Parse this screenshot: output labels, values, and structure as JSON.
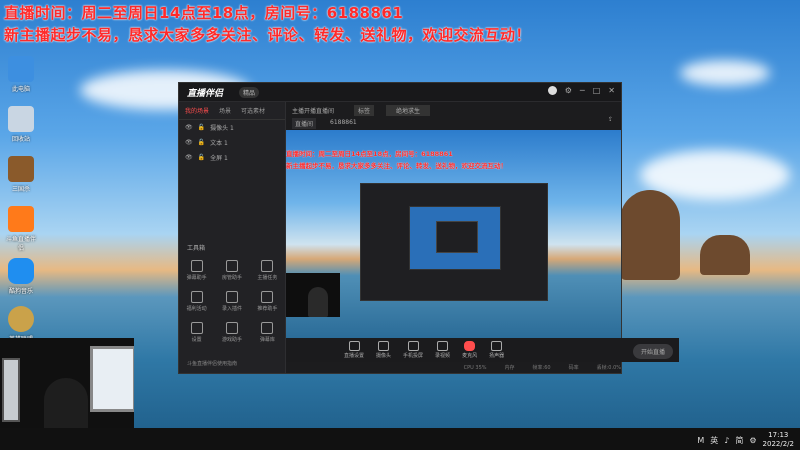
{
  "banner": {
    "line1": "直播时间：周二至周日14点至18点，房间号：6188861",
    "line2": "新主播起步不易，恳求大家多多关注、评论、转发、送礼物，欢迎交流互动！"
  },
  "desktop_icons": [
    {
      "label": "此电脑",
      "icon": "computer-icon",
      "color": "#3d8fe0"
    },
    {
      "label": "回收站",
      "icon": "recycle-bin-icon",
      "color": "#c9d6e3"
    },
    {
      "label": "三国杀",
      "icon": "game-icon",
      "color": "#8a5a2b"
    },
    {
      "label": "斗鱼直播伴侣",
      "icon": "app-icon",
      "color": "#ff7a1a"
    },
    {
      "label": "酷狗音乐",
      "icon": "kugou-icon",
      "color": "#1f8ef0"
    },
    {
      "label": "英雄联盟",
      "icon": "lol-icon",
      "color": "#caa24a"
    }
  ],
  "app": {
    "title": "直播伴侣",
    "badge": "精品",
    "tabs": [
      "我的场景",
      "场景",
      "可选素材"
    ],
    "scenes": [
      "摄像头 1",
      "文本 1",
      "全屏 1"
    ],
    "tools_title": "工具箱",
    "tools": [
      "弹幕助手",
      "房管助手",
      "主播任务",
      "福利活动",
      "录入插件",
      "推荐助手",
      "设置",
      "游戏助手",
      "弹幕库",
      "聊天",
      "直播间",
      "直播间"
    ],
    "tools_footer": "斗鱼直播伴侣使用指南",
    "stream_info": {
      "title_label": "主播开播直播间",
      "tag": "标签",
      "category": "绝地求生",
      "room_label": "直播间",
      "room_id": "6188861"
    },
    "preview_text": {
      "line1": "直播时间：周二至周日14点至18点，房间号：6188861",
      "line2": "新主播起步不易，恳求大家多多关注、评论、转发、送礼物，欢迎交流互动！"
    },
    "controls": [
      "直播设置",
      "摄像头",
      "手机投屏",
      "录视频",
      "麦克风",
      "扬声器"
    ],
    "go_live": "开始直播",
    "status": [
      "CPU 35%",
      "内存",
      "帧率:60",
      "码率",
      "丢帧:0.0%"
    ]
  },
  "taskbar": {
    "tray_icons": [
      "M",
      "英",
      "♪",
      "简",
      "⚙"
    ],
    "time": "17:13",
    "date": "2022/2/2"
  }
}
